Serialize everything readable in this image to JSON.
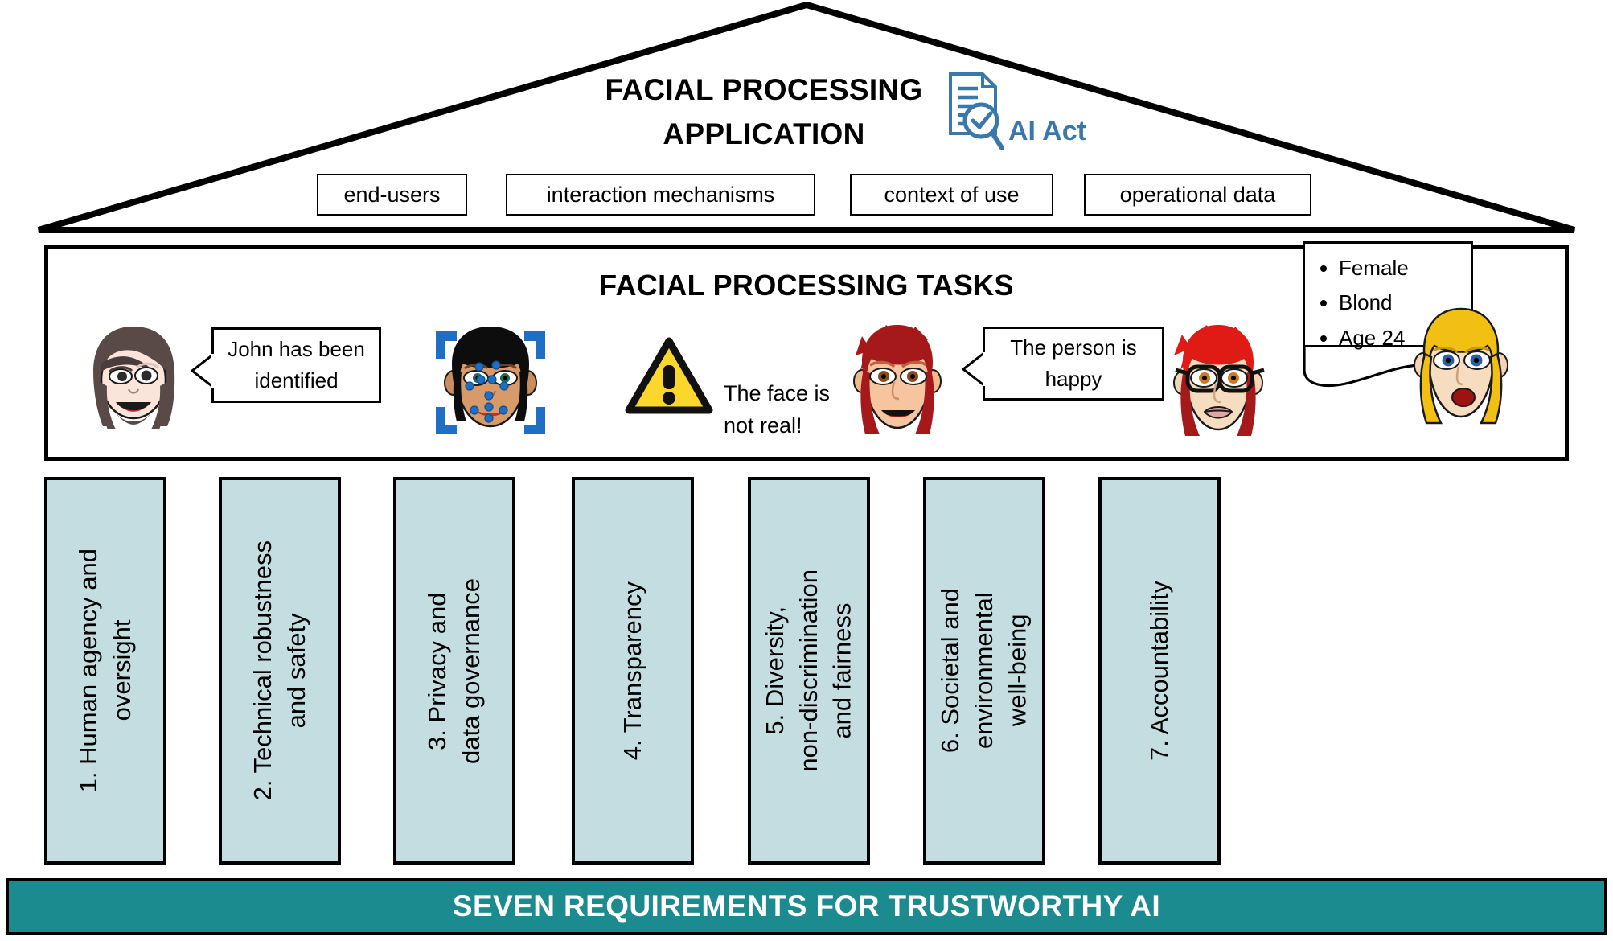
{
  "roof": {
    "title": "FACIAL PROCESSING\nAPPLICATION",
    "ai_act_label": "AI Act",
    "ai_act_icon": "document-magnifier-check-icon",
    "ai_act_color": "#3878aa",
    "chips": [
      {
        "label": "end-users"
      },
      {
        "label": "interaction mechanisms"
      },
      {
        "label": "context of use"
      },
      {
        "label": "operational data"
      }
    ]
  },
  "tasks": {
    "title": "FACIAL PROCESSING TASKS",
    "items": [
      {
        "icon": "face-identification-icon",
        "callout_type": "speech-bubble",
        "callout_text": "John has been\nidentified"
      },
      {
        "icon": "face-landmark-detection-icon",
        "callout_type": "none",
        "callout_text": ""
      },
      {
        "icon": "warning-triangle-icon",
        "callout_type": "plain-text",
        "callout_text": "The face is\nnot real!"
      },
      {
        "icon": "face-emotion-icon",
        "callout_type": "speech-bubble",
        "callout_text": "The person is\nhappy"
      },
      {
        "icon": "face-attributes-icon",
        "callout_type": "list-box",
        "callout_items": [
          "Female",
          "Blond",
          "Age 24"
        ]
      }
    ]
  },
  "pillars": {
    "fill_color": "#c3dde0",
    "items": [
      {
        "label": "1. Human agency and\noversight"
      },
      {
        "label": "2. Technical robustness\nand safety"
      },
      {
        "label": "3. Privacy and\ndata governance"
      },
      {
        "label": "4. Transparency"
      },
      {
        "label": "5. Diversity,\nnon-discrimination\nand fairness"
      },
      {
        "label": "6. Societal and\nenvironmental\nwell-being"
      },
      {
        "label": "7. Accountability"
      }
    ]
  },
  "footer": {
    "label": "SEVEN REQUIREMENTS FOR TRUSTWORTHY AI",
    "background_color": "#1c8b90",
    "text_color": "#ffffff"
  }
}
